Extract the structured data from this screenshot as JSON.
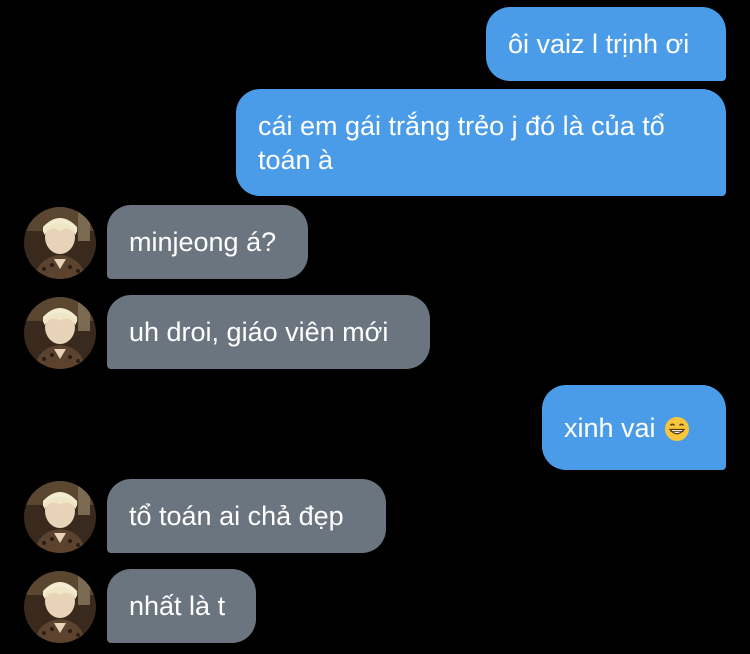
{
  "messages": [
    {
      "side": "sent",
      "text": "ôi vaiz l trịnh ơi"
    },
    {
      "side": "sent",
      "text": "cái em gái trắng trẻo j đó là của tổ toán à"
    },
    {
      "side": "received",
      "text": "minjeong á?"
    },
    {
      "side": "received",
      "text": "uh droi, giáo viên mới"
    },
    {
      "side": "sent",
      "text": "xinh vai",
      "emoji": "grinning-face-emoji"
    },
    {
      "side": "received",
      "text": "tổ toán ai chả đẹp"
    },
    {
      "side": "received",
      "text": "nhất là t"
    }
  ],
  "colors": {
    "background": "#000000",
    "sent_bubble": "#4b9ce8",
    "received_bubble": "#6b7580",
    "text": "#ffffff"
  }
}
